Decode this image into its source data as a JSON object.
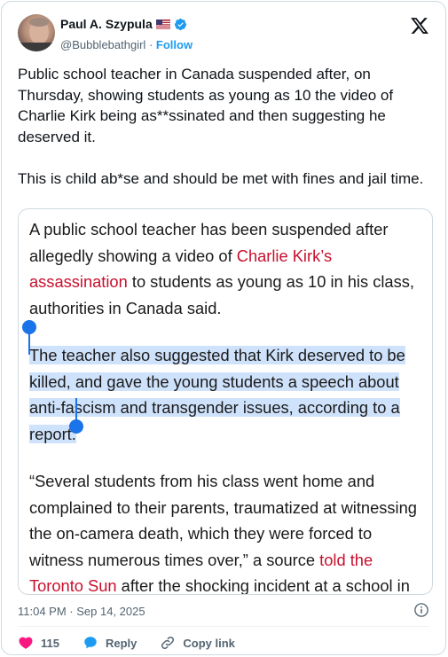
{
  "author": {
    "name": "Paul A. Szypula",
    "handle": "@Bubblebathgirl",
    "separator": "·",
    "follow_label": "Follow"
  },
  "tweet": {
    "text": "Public school teacher in Canada suspended after, on Thursday, showing students as young as 10 the video of Charlie Kirk being as**ssinated and then suggesting he deserved it.\n\nThis is child ab*se and should be met with fines and jail time."
  },
  "embed": {
    "p1_a": "A public school teacher has been suspended after allegedly showing a video of ",
    "p1_link": "Charlie Kirk’s assassination",
    "p1_b": " to students as young as 10 in his class, authorities in Canada said.",
    "p2": "The teacher also suggested that Kirk deserved to be killed, and gave the young students a speech about anti-fascism and transgender issues, according to a report.",
    "p3_a": "“Several students from his class went home and complained to their parents, traumatized at witnessing the on-camera death, which they were forced to witness numerous times over,” a source ",
    "p3_link": "told the Toronto Sun",
    "p3_b": " after the shocking incident at a school in Toronto on Thursday."
  },
  "footer": {
    "timestamp": "11:04 PM · Sep 14, 2025",
    "likes": "115",
    "reply_label": "Reply",
    "copy_link_label": "Copy link"
  },
  "colors": {
    "brand_blue": "#1d9bf0",
    "like_pink": "#f91880",
    "link_red": "#c8102e",
    "highlight": "#cfe2fb"
  },
  "icons": [
    "verified-badge-icon",
    "us-flag-icon",
    "x-logo-icon",
    "info-icon",
    "heart-icon",
    "reply-bubble-icon",
    "link-icon"
  ]
}
